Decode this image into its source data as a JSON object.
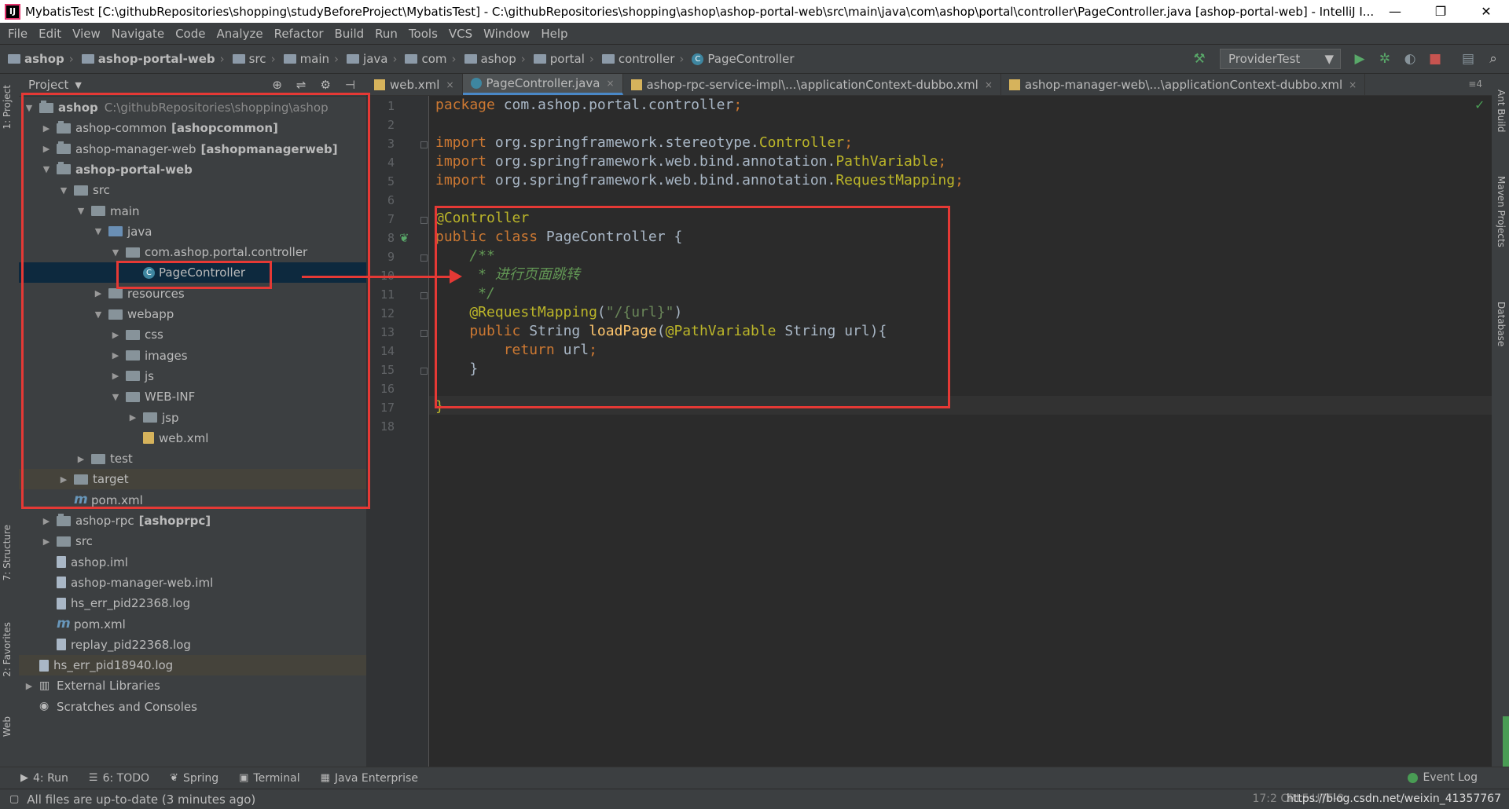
{
  "window": {
    "title": "MybatisTest [C:\\githubRepositories\\shopping\\studyBeforeProject\\MybatisTest] - C:\\githubRepositories\\shopping\\ashop\\ashop-portal-web\\src\\main\\java\\com\\ashop\\portal\\controller\\PageController.java [ashop-portal-web] - IntelliJ I...",
    "app_icon": "IJ",
    "minimize": "—",
    "maximize": "❐",
    "close": "✕"
  },
  "menu": [
    "File",
    "Edit",
    "View",
    "Navigate",
    "Code",
    "Analyze",
    "Refactor",
    "Build",
    "Run",
    "Tools",
    "VCS",
    "Window",
    "Help"
  ],
  "breadcrumbs": [
    "ashop",
    "ashop-portal-web",
    "src",
    "main",
    "java",
    "com",
    "ashop",
    "portal",
    "controller",
    "PageController"
  ],
  "run_config": {
    "label": "ProviderTest",
    "arrow": "▼"
  },
  "toolbar_icons": {
    "build": "hammer-icon",
    "run": "run-icon",
    "debug": "debug-icon",
    "coverage": "coverage-icon",
    "stop": "stop-icon",
    "structure": "project-structure-icon",
    "search": "search-icon"
  },
  "left_tool_windows": {
    "project": "1: Project",
    "structure": "7: Structure",
    "favorites": "2: Favorites",
    "web": "Web"
  },
  "right_tool_windows": {
    "ant": "Ant Build",
    "maven": "Maven Projects",
    "database": "Database"
  },
  "project_panel": {
    "title": "Project",
    "dropdown": "▼",
    "tools": [
      "⊕",
      "⇌",
      "⚙",
      "⊣"
    ],
    "tree": [
      {
        "label": "ashop",
        "bold": true,
        "extra": "C:\\githubRepositories\\shopping\\ashop",
        "depth": 0,
        "toggle": "▼",
        "icon": "module"
      },
      {
        "label": "ashop-common",
        "extra_bold": "[ashopcommon]",
        "depth": 1,
        "toggle": "▶",
        "icon": "module"
      },
      {
        "label": "ashop-manager-web",
        "extra_bold": "[ashopmanagerweb]",
        "depth": 1,
        "toggle": "▶",
        "icon": "module"
      },
      {
        "label": "ashop-portal-web",
        "bold": true,
        "depth": 1,
        "toggle": "▼",
        "icon": "module"
      },
      {
        "label": "src",
        "depth": 2,
        "toggle": "▼",
        "icon": "folder"
      },
      {
        "label": "main",
        "depth": 3,
        "toggle": "▼",
        "icon": "folder"
      },
      {
        "label": "java",
        "depth": 4,
        "toggle": "▼",
        "icon": "src"
      },
      {
        "label": "com.ashop.portal.controller",
        "depth": 5,
        "toggle": "▼",
        "icon": "pkg"
      },
      {
        "label": "PageController",
        "depth": 6,
        "toggle": "",
        "icon": "class",
        "selected": true
      },
      {
        "label": "resources",
        "depth": 4,
        "toggle": "▶",
        "icon": "res"
      },
      {
        "label": "webapp",
        "depth": 4,
        "toggle": "▼",
        "icon": "folder"
      },
      {
        "label": "css",
        "depth": 5,
        "toggle": "▶",
        "icon": "folder"
      },
      {
        "label": "images",
        "depth": 5,
        "toggle": "▶",
        "icon": "folder"
      },
      {
        "label": "js",
        "depth": 5,
        "toggle": "▶",
        "icon": "folder"
      },
      {
        "label": "WEB-INF",
        "depth": 5,
        "toggle": "▼",
        "icon": "folder"
      },
      {
        "label": "jsp",
        "depth": 6,
        "toggle": "▶",
        "icon": "folder"
      },
      {
        "label": "web.xml",
        "depth": 6,
        "toggle": "",
        "icon": "xml"
      },
      {
        "label": "test",
        "depth": 3,
        "toggle": "▶",
        "icon": "folder"
      },
      {
        "label": "target",
        "depth": 2,
        "toggle": "▶",
        "icon": "folder",
        "dim": true
      },
      {
        "label": "pom.xml",
        "depth": 2,
        "toggle": "",
        "icon": "mvn"
      },
      {
        "label": "ashop-rpc",
        "extra_bold": "[ashoprpc]",
        "depth": 1,
        "toggle": "▶",
        "icon": "module"
      },
      {
        "label": "src",
        "depth": 1,
        "toggle": "▶",
        "icon": "folder"
      },
      {
        "label": "ashop.iml",
        "depth": 1,
        "toggle": "",
        "icon": "file"
      },
      {
        "label": "ashop-manager-web.iml",
        "depth": 1,
        "toggle": "",
        "icon": "file"
      },
      {
        "label": "hs_err_pid22368.log",
        "depth": 1,
        "toggle": "",
        "icon": "file"
      },
      {
        "label": "pom.xml",
        "depth": 1,
        "toggle": "",
        "icon": "mvn"
      },
      {
        "label": "replay_pid22368.log",
        "depth": 1,
        "toggle": "",
        "icon": "file"
      },
      {
        "label": "hs_err_pid18940.log",
        "depth": 0,
        "toggle": "",
        "icon": "file",
        "dim": true
      },
      {
        "label": "External Libraries",
        "depth": 0,
        "toggle": "▶",
        "icon": "lib"
      },
      {
        "label": "Scratches and Consoles",
        "depth": 0,
        "toggle": "",
        "icon": "scr"
      }
    ]
  },
  "editor_tabs": [
    {
      "label": "web.xml",
      "icon": "xml",
      "active": false
    },
    {
      "label": "PageController.java",
      "icon": "java",
      "active": true
    },
    {
      "label": "ashop-rpc-service-impl\\...\\applicationContext-dubbo.xml",
      "icon": "xml",
      "active": false
    },
    {
      "label": "ashop-manager-web\\...\\applicationContext-dubbo.xml",
      "icon": "xml",
      "active": false
    }
  ],
  "editor_tabs_more": "≡4",
  "tab_close": "×",
  "code_lines": [
    [
      {
        "t": "package ",
        "c": "kw"
      },
      {
        "t": "com.ashop.portal.controller",
        "c": ""
      },
      {
        "t": ";",
        "c": "kw"
      }
    ],
    [],
    [
      {
        "t": "import ",
        "c": "kw"
      },
      {
        "t": "org.springframework.stereotype.",
        "c": ""
      },
      {
        "t": "Controller",
        "c": "ann"
      },
      {
        "t": ";",
        "c": "kw"
      }
    ],
    [
      {
        "t": "import ",
        "c": "kw"
      },
      {
        "t": "org.springframework.web.bind.annotation.",
        "c": ""
      },
      {
        "t": "PathVariable",
        "c": "ann"
      },
      {
        "t": ";",
        "c": "kw"
      }
    ],
    [
      {
        "t": "import ",
        "c": "kw"
      },
      {
        "t": "org.springframework.web.bind.annotation.",
        "c": ""
      },
      {
        "t": "RequestMapping",
        "c": "ann"
      },
      {
        "t": ";",
        "c": "kw"
      }
    ],
    [],
    [
      {
        "t": "@Controller",
        "c": "ann"
      }
    ],
    [
      {
        "t": "public class ",
        "c": "kw"
      },
      {
        "t": "PageController ",
        "c": ""
      },
      {
        "t": "{",
        "c": ""
      }
    ],
    [
      {
        "t": "    /**",
        "c": "doc"
      }
    ],
    [
      {
        "t": "     * 进行页面跳转",
        "c": "doc"
      }
    ],
    [
      {
        "t": "     */",
        "c": "doc"
      }
    ],
    [
      {
        "t": "    @RequestMapping",
        "c": "ann"
      },
      {
        "t": "(",
        "c": ""
      },
      {
        "t": "\"/{url}\"",
        "c": "str"
      },
      {
        "t": ")",
        "c": ""
      }
    ],
    [
      {
        "t": "    public ",
        "c": "kw"
      },
      {
        "t": "String ",
        "c": ""
      },
      {
        "t": "loadPage",
        "c": "fn"
      },
      {
        "t": "(",
        "c": ""
      },
      {
        "t": "@PathVariable ",
        "c": "ann"
      },
      {
        "t": "String url){",
        "c": ""
      }
    ],
    [
      {
        "t": "        return ",
        "c": "kw"
      },
      {
        "t": "url",
        "c": ""
      },
      {
        "t": ";",
        "c": "kw"
      }
    ],
    [
      {
        "t": "    }",
        "c": ""
      }
    ],
    [],
    [
      {
        "t": "}",
        "c": "ann"
      }
    ],
    []
  ],
  "bottom_tabs": [
    {
      "icon": "▶",
      "label": "4: Run"
    },
    {
      "icon": "☰",
      "label": "6: TODO"
    },
    {
      "icon": "❦",
      "label": "Spring"
    },
    {
      "icon": "▣",
      "label": "Terminal"
    },
    {
      "icon": "▦",
      "label": "Java Enterprise"
    }
  ],
  "event_log": "Event Log",
  "status": {
    "message": "All files are up-to-date (3 minutes ago)",
    "right": "https://blog.csdn.net/weixin_41357767",
    "position": "17:2  CRLF  UTF-8"
  },
  "colors": {
    "accent": "#4a88c7",
    "highlight": "#e53935",
    "background": "#2b2b2b",
    "panel": "#3c3f41"
  }
}
